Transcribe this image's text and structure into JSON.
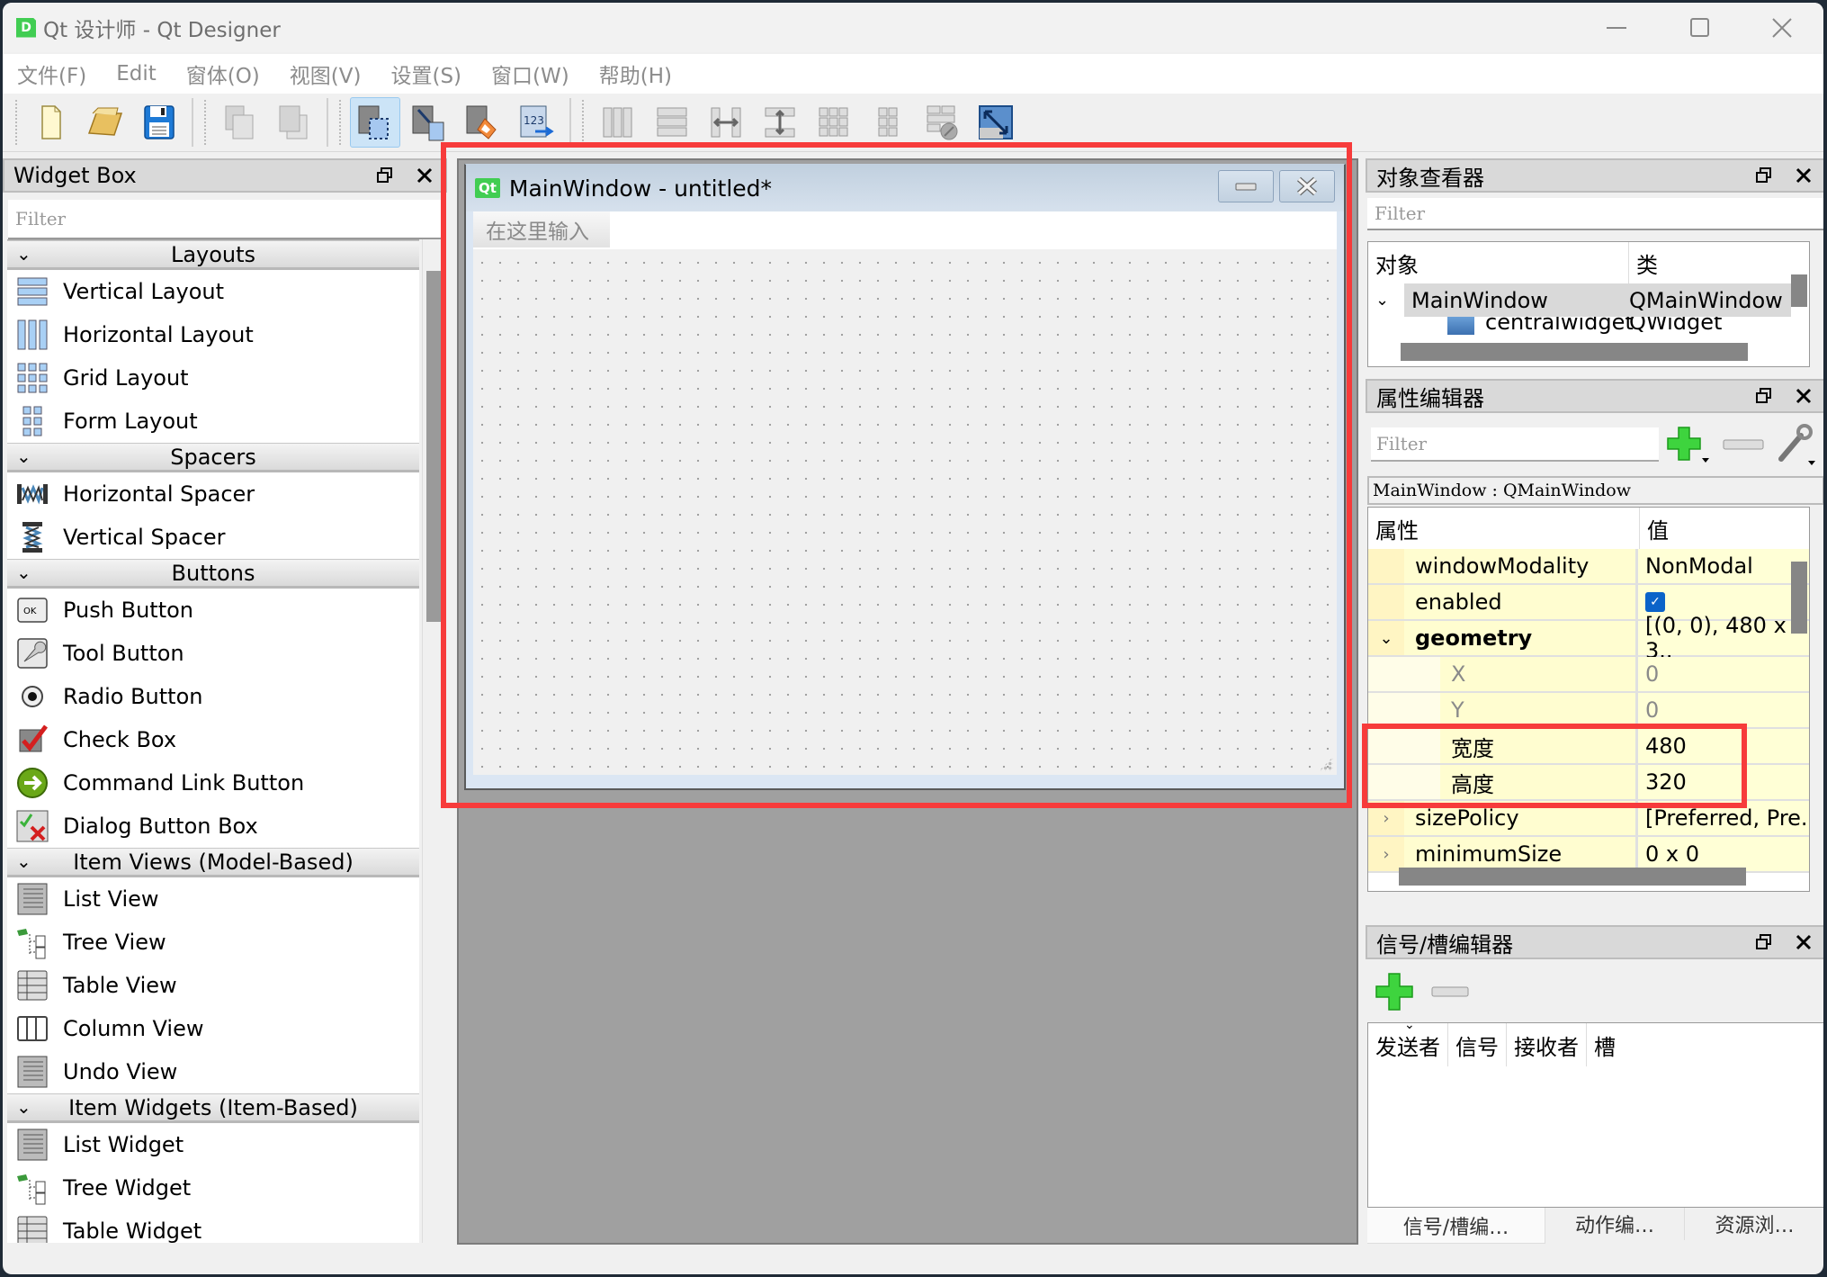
{
  "window": {
    "title": "Qt 设计师 - Qt Designer",
    "logo_letter": "D",
    "controls": {
      "minimize": "—",
      "maximize": "☐",
      "close": "✕"
    }
  },
  "menubar": [
    "文件(F)",
    "Edit",
    "窗体(O)",
    "视图(V)",
    "设置(S)",
    "窗口(W)",
    "帮助(H)"
  ],
  "toolbar": {
    "groups": [
      [
        "new-file-icon",
        "open-folder-icon",
        "save-icon"
      ],
      [
        "send-to-back-icon",
        "bring-to-front-icon"
      ],
      [
        "edit-widgets-icon",
        "edit-signals-slots-icon",
        "edit-buddies-icon",
        "edit-tab-order-icon"
      ],
      [
        "layout-horizontal-icon",
        "layout-vertical-icon",
        "layout-h-splitter-icon",
        "layout-v-splitter-icon",
        "layout-grid-icon",
        "layout-form-icon",
        "break-layout-icon",
        "adjust-size-icon"
      ]
    ],
    "active": "edit-widgets-icon"
  },
  "widget_box": {
    "title": "Widget Box",
    "filter_placeholder": "Filter",
    "categories": [
      {
        "label": "Layouts",
        "items": [
          {
            "label": "Vertical Layout",
            "icon": "vertical-layout-icon"
          },
          {
            "label": "Horizontal Layout",
            "icon": "horizontal-layout-icon"
          },
          {
            "label": "Grid Layout",
            "icon": "grid-layout-icon"
          },
          {
            "label": "Form Layout",
            "icon": "form-layout-icon"
          }
        ]
      },
      {
        "label": "Spacers",
        "items": [
          {
            "label": "Horizontal Spacer",
            "icon": "horizontal-spacer-icon"
          },
          {
            "label": "Vertical Spacer",
            "icon": "vertical-spacer-icon"
          }
        ]
      },
      {
        "label": "Buttons",
        "items": [
          {
            "label": "Push Button",
            "icon": "push-button-icon"
          },
          {
            "label": "Tool Button",
            "icon": "tool-button-icon"
          },
          {
            "label": "Radio Button",
            "icon": "radio-button-icon"
          },
          {
            "label": "Check Box",
            "icon": "check-box-icon"
          },
          {
            "label": "Command Link Button",
            "icon": "command-link-icon"
          },
          {
            "label": "Dialog Button Box",
            "icon": "dialog-button-box-icon"
          }
        ]
      },
      {
        "label": "Item Views (Model-Based)",
        "items": [
          {
            "label": "List View",
            "icon": "list-view-icon"
          },
          {
            "label": "Tree View",
            "icon": "tree-view-icon"
          },
          {
            "label": "Table View",
            "icon": "table-view-icon"
          },
          {
            "label": "Column View",
            "icon": "column-view-icon"
          },
          {
            "label": "Undo View",
            "icon": "undo-view-icon"
          }
        ]
      },
      {
        "label": "Item Widgets (Item-Based)",
        "items": [
          {
            "label": "List Widget",
            "icon": "list-widget-icon"
          },
          {
            "label": "Tree Widget",
            "icon": "tree-widget-icon"
          },
          {
            "label": "Table Widget",
            "icon": "table-widget-icon"
          }
        ]
      }
    ]
  },
  "form": {
    "badge": "Qt",
    "title": "MainWindow - untitled*",
    "menu_placeholder": "在这里输入"
  },
  "object_inspector": {
    "title": "对象查看器",
    "filter_placeholder": "Filter",
    "columns": [
      "对象",
      "类"
    ],
    "rows": [
      {
        "object": "MainWindow",
        "class": "QMainWindow",
        "expanded": true
      },
      {
        "object": "centralwidget",
        "class": "QWidget"
      }
    ]
  },
  "property_editor": {
    "title": "属性编辑器",
    "filter_placeholder": "Filter",
    "object_class": "MainWindow : QMainWindow",
    "columns": [
      "属性",
      "值"
    ],
    "rows": [
      {
        "name": "windowModality",
        "value": "NonModal"
      },
      {
        "name": "enabled",
        "value": "",
        "checked": true
      },
      {
        "name": "geometry",
        "value": "[(0, 0), 480 x 3..",
        "expanded": true
      },
      {
        "name": "X",
        "value": "0"
      },
      {
        "name": "Y",
        "value": "0"
      },
      {
        "name": "宽度",
        "value": "480"
      },
      {
        "name": "高度",
        "value": "320"
      },
      {
        "name": "sizePolicy",
        "value": "[Preferred, Pre.",
        "collapsed": true
      },
      {
        "name": "minimumSize",
        "value": "0 x 0",
        "collapsed": true
      }
    ]
  },
  "signal_slot_editor": {
    "title": "信号/槽编辑器",
    "columns": [
      "发送者",
      "信号",
      "接收者",
      "槽"
    ],
    "tabs": [
      "信号/槽编…",
      "动作编…",
      "资源浏…"
    ],
    "active_tab": 0
  },
  "highlight_color": "#f73b3b"
}
